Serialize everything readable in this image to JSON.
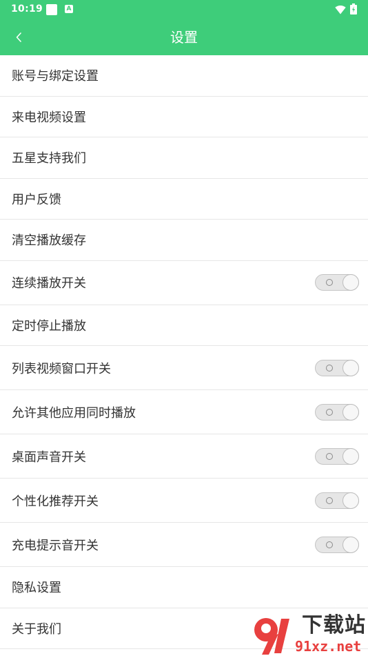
{
  "status_bar": {
    "time": "10:19",
    "notification_badge": "A",
    "icons": [
      "square-notification-icon",
      "a-notification-icon",
      "wifi-icon",
      "battery-icon"
    ]
  },
  "toolbar": {
    "title": "设置",
    "back_icon": "chevron-left-icon"
  },
  "colors": {
    "accent": "#3ecd7a",
    "text": "#333333",
    "divider": "#e6e6e6",
    "watermark_red": "#e8403f"
  },
  "settings": {
    "items": [
      {
        "label": "账号与绑定设置",
        "has_switch": false
      },
      {
        "label": "来电视频设置",
        "has_switch": false
      },
      {
        "label": "五星支持我们",
        "has_switch": false
      },
      {
        "label": "用户反馈",
        "has_switch": false
      },
      {
        "label": "清空播放缓存",
        "has_switch": false
      },
      {
        "label": "连续播放开关",
        "has_switch": true,
        "on": false
      },
      {
        "label": "定时停止播放",
        "has_switch": false
      },
      {
        "label": "列表视频窗口开关",
        "has_switch": true,
        "on": false
      },
      {
        "label": "允许其他应用同时播放",
        "has_switch": true,
        "on": false
      },
      {
        "label": "桌面声音开关",
        "has_switch": true,
        "on": false
      },
      {
        "label": "个性化推荐开关",
        "has_switch": true,
        "on": false
      },
      {
        "label": "充电提示音开关",
        "has_switch": true,
        "on": false
      },
      {
        "label": "隐私设置",
        "has_switch": false
      },
      {
        "label": "关于我们",
        "has_switch": false
      }
    ]
  },
  "watermark": {
    "logo_text": "9",
    "title": "下载站",
    "url": "91xz.net"
  }
}
